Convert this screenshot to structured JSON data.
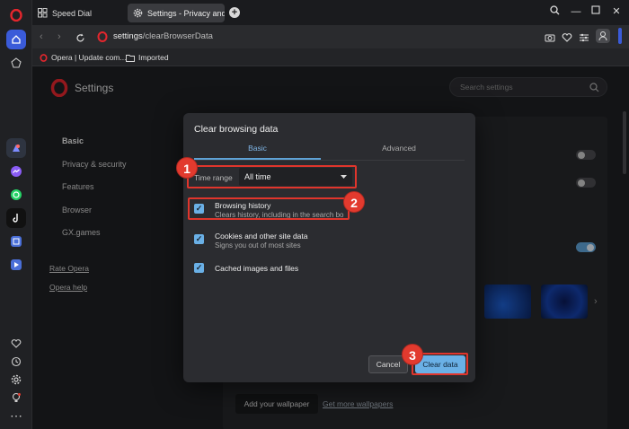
{
  "tabs": [
    {
      "label": "Speed Dial",
      "active": false
    },
    {
      "label": "Settings - Privacy and sec",
      "active": true
    }
  ],
  "window_controls": {
    "search_icon": "search-icon",
    "minimize": "minimize-icon",
    "maximize": "maximize-icon",
    "close": "close-icon",
    "menu": "menu-lines-icon"
  },
  "address": {
    "host": "settings",
    "path": "/clearBrowserData"
  },
  "bookmarks": [
    {
      "label": "Opera | Update com...",
      "icon": "opera-icon"
    },
    {
      "label": "Imported",
      "icon": "folder-icon"
    }
  ],
  "settings": {
    "title": "Settings",
    "search_placeholder": "Search settings",
    "nav": [
      "Basic",
      "Privacy & security",
      "Features",
      "Browser",
      "GX.games"
    ],
    "links": [
      "Rate Opera",
      "Opera help"
    ],
    "add_wallpaper_label": "Add your wallpaper",
    "more_wallpapers_label": "Get more wallpapers"
  },
  "dialog": {
    "title": "Clear browsing data",
    "tabs": [
      {
        "label": "Basic",
        "active": true
      },
      {
        "label": "Advanced",
        "active": false
      }
    ],
    "time_range_label": "Time range",
    "time_range_value": "All time",
    "options": [
      {
        "title": "Browsing history",
        "subtitle": "Clears history, including in the search bo",
        "checked": true
      },
      {
        "title": "Cookies and other site data",
        "subtitle": "Signs you out of most sites",
        "checked": true
      },
      {
        "title": "Cached images and files",
        "subtitle": "",
        "checked": true
      }
    ],
    "cancel_label": "Cancel",
    "clear_label": "Clear data"
  },
  "annotations": [
    "1",
    "2",
    "3"
  ],
  "colors": {
    "accent": "#5ea2d6",
    "annotation_red": "#e23a2e",
    "opera_red": "#e3262d",
    "dialog_bg": "#2b2c30"
  }
}
